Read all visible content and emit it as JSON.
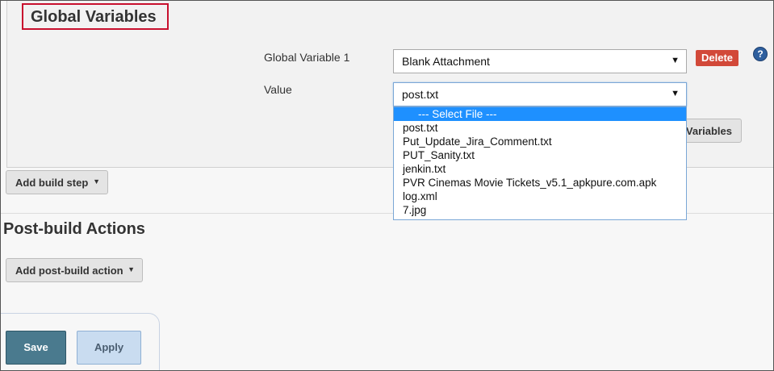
{
  "global_variables": {
    "title": "Global Variables",
    "variable_label": "Global Variable 1",
    "variable_selected": "Blank Attachment",
    "value_label": "Value",
    "value_selected": "post.txt",
    "delete_label": "Delete",
    "help_glyph": "?",
    "add_variables_partial_label": "Variables"
  },
  "dropdown": {
    "options": [
      "--- Select File ---",
      "post.txt",
      "Put_Update_Jira_Comment.txt",
      "PUT_Sanity.txt",
      "jenkin.txt",
      "PVR Cinemas Movie Tickets_v5.1_apkpure.com.apk",
      "log.xml",
      "7.jpg"
    ],
    "highlighted_index": 0
  },
  "build": {
    "add_build_step_label": "Add build step"
  },
  "post_build": {
    "title": "Post-build Actions",
    "add_post_build_label": "Add post-build action"
  },
  "footer": {
    "save_label": "Save",
    "apply_label": "Apply"
  },
  "icons": {
    "select_arrow": "▼",
    "button_caret": "▼"
  },
  "colors": {
    "highlight_box": "#c8102e",
    "delete": "#d24939",
    "selected_option": "#1e90ff",
    "save": "#4a7a8e",
    "apply": "#c9dcf0"
  }
}
